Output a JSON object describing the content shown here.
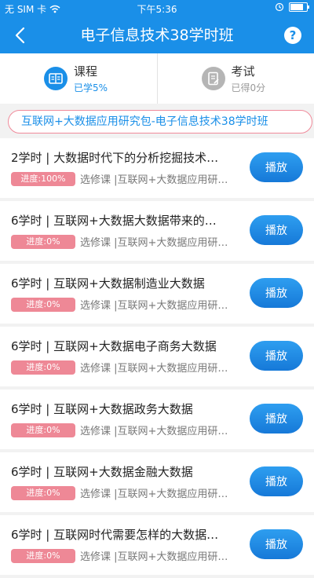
{
  "status": {
    "carrier": "无 SIM 卡",
    "time": "下午5:36",
    "battery_fraction": 0.9
  },
  "nav": {
    "title": "电子信息技术38学时班",
    "back_icon": "chevron-left-icon",
    "help_label": "?"
  },
  "tabs": [
    {
      "title": "课程",
      "sub": "已学5%",
      "icon": "book-icon"
    },
    {
      "title": "考试",
      "sub": "已得0分",
      "icon": "exam-icon"
    }
  ],
  "banner": {
    "text": "互联网+大数据应用研究包-电子信息技术38学时班"
  },
  "courses": [
    {
      "title": "2学时 | 大数据时代下的分析挖掘技术…",
      "progress": "进度:100%",
      "meta": "选修课 |互联网+大数据应用研…",
      "play": "播放"
    },
    {
      "title": "6学时 | 互联网+大数据大数据带来的…",
      "progress": "进度:0%",
      "meta": "选修课 |互联网+大数据应用研…",
      "play": "播放"
    },
    {
      "title": "6学时 | 互联网+大数据制造业大数据",
      "progress": "进度:0%",
      "meta": "选修课 |互联网+大数据应用研…",
      "play": "播放"
    },
    {
      "title": "6学时 | 互联网+大数据电子商务大数据",
      "progress": "进度:0%",
      "meta": "选修课 |互联网+大数据应用研…",
      "play": "播放"
    },
    {
      "title": "6学时 | 互联网+大数据政务大数据",
      "progress": "进度:0%",
      "meta": "选修课 |互联网+大数据应用研…",
      "play": "播放"
    },
    {
      "title": "6学时 | 互联网+大数据金融大数据",
      "progress": "进度:0%",
      "meta": "选修课 |互联网+大数据应用研…",
      "play": "播放"
    },
    {
      "title": "6学时 | 互联网时代需要怎样的大数据…",
      "progress": "进度:0%",
      "meta": "选修课 |互联网+大数据应用研…",
      "play": "播放"
    }
  ]
}
